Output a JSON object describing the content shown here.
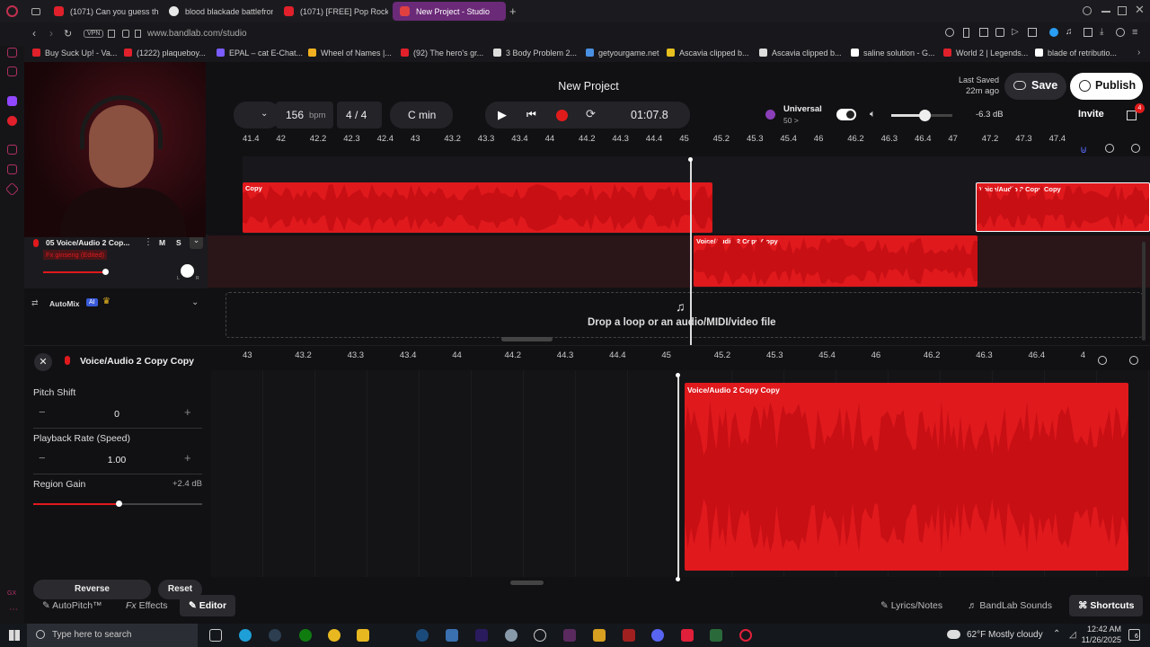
{
  "browser": {
    "tabs": [
      {
        "label": "(1071) Can you guess the",
        "color": "#e0202a"
      },
      {
        "label": "blood blackade battlefron",
        "color": "#e8e8e8"
      },
      {
        "label": "(1071) [FREE] Pop Rock x",
        "color": "#e0202a"
      },
      {
        "label": "New Project - Studio",
        "color": "#e04040"
      }
    ],
    "url": "www.bandlab.com/studio",
    "vpn": "VPN",
    "bookmarks": [
      {
        "label": "Buy Suck Up! - Va...",
        "color": "#e0202a"
      },
      {
        "label": "(1222) plaqueboy...",
        "color": "#e0202a"
      },
      {
        "label": "EPAL – cat E-Chat...",
        "color": "#7a5cff"
      },
      {
        "label": "Wheel of Names |...",
        "color": "#f0b020"
      },
      {
        "label": "(92) The hero's gr...",
        "color": "#e0202a"
      },
      {
        "label": "3 Body Problem 2...",
        "color": "#dddddd"
      },
      {
        "label": "getyourgame.net",
        "color": "#4a90e2"
      },
      {
        "label": "Ascavia clipped b...",
        "color": "#e8c020"
      },
      {
        "label": "Ascavia clipped b...",
        "color": "#dddddd"
      },
      {
        "label": "saline solution - G...",
        "color": "#ffffff"
      },
      {
        "label": "World 2 | Legends...",
        "color": "#e0202a"
      },
      {
        "label": "blade of retributio...",
        "color": "#ffffff"
      }
    ]
  },
  "header": {
    "project_title": "New Project",
    "last_saved_label": "Last Saved",
    "last_saved_value": "22m ago",
    "save_label": "Save",
    "publish_label": "Publish",
    "invite_label": "Invite",
    "gift_badge": "4"
  },
  "transport": {
    "bpm": "156",
    "bpm_unit": "bpm",
    "time_sig": "4 / 4",
    "key": "C min",
    "time": "01:07.8",
    "universal_label": "Universal",
    "universal_value": "50 >",
    "volume_db": "-6.3 dB",
    "volume_level": 0.55
  },
  "ruler_top": [
    "41.4",
    "42",
    "42.2",
    "42.3",
    "42.4",
    "43",
    "43.2",
    "43.3",
    "43.4",
    "44",
    "44.2",
    "44.3",
    "44.4",
    "45",
    "45.2",
    "45.3",
    "45.4",
    "46",
    "46.2",
    "46.3",
    "46.4",
    "47",
    "47.2",
    "47.3",
    "47.4"
  ],
  "tracks": {
    "clip1_label": "Copy",
    "clip2_label": "Voice/Audio 2 Copy Copy",
    "clip3_label": "Voice/Audio 2 Copy Copy",
    "track5_name": "05  Voice/Audio 2 Cop...",
    "track5_fx": "Fx ginseng (Edited)",
    "mute": "M",
    "solo": "S",
    "pan_l": "L",
    "pan_r": "R",
    "automix_label": "AutoMix",
    "ai_badge": "AI",
    "drop_text": "Drop a loop or an audio/MIDI/video file"
  },
  "editor": {
    "title": "Voice/Audio 2 Copy Copy",
    "pitch_label": "Pitch Shift",
    "pitch_value": "0",
    "rate_label": "Playback Rate (Speed)",
    "rate_value": "1.00",
    "gain_label": "Region Gain",
    "gain_value": "+2.4 dB",
    "reverse_label": "Reverse",
    "reset_label": "Reset",
    "clip_label": "Voice/Audio 2 Copy Copy",
    "ruler": [
      "43",
      "43.2",
      "43.3",
      "43.4",
      "44",
      "44.2",
      "44.3",
      "44.4",
      "45",
      "45.2",
      "45.3",
      "45.4",
      "46",
      "46.2",
      "46.3",
      "46.4",
      "4"
    ]
  },
  "bottom_tabs": {
    "autopitch": "AutoPitch™",
    "effects": "Effects",
    "editor": "Editor",
    "lyrics": "Lyrics/Notes",
    "sounds": "BandLab Sounds",
    "shortcuts": "Shortcuts"
  },
  "taskbar": {
    "search_placeholder": "Type here to search",
    "weather": "62°F  Mostly cloudy",
    "time": "12:42 AM",
    "date": "11/26/2025",
    "notif_count": "6",
    "gx": "GX"
  }
}
